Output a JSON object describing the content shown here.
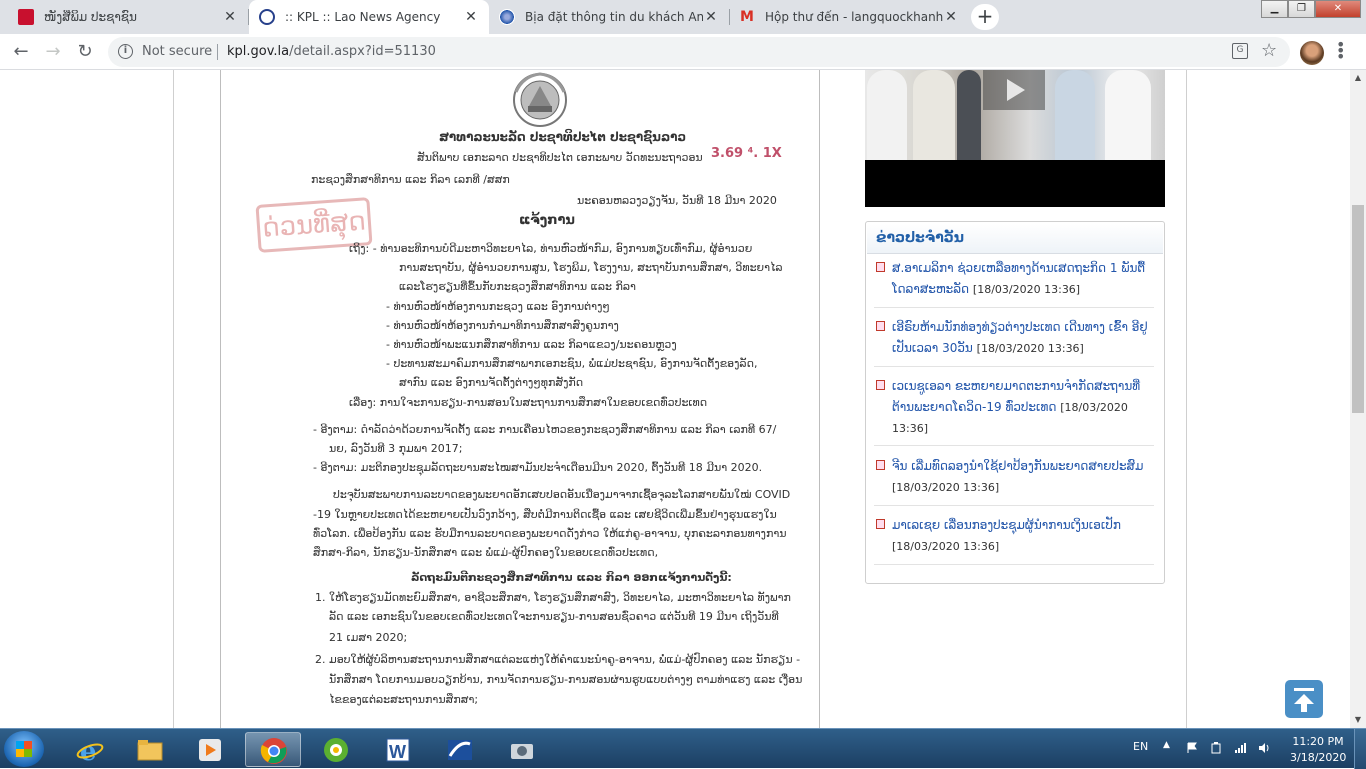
{
  "tabs": [
    {
      "title": "ໜັງສືພິມ ປະຊາຊົນ",
      "favicon": "pasaxon-icon",
      "active": false
    },
    {
      "title": ":: KPL :: Lao News Agency",
      "favicon": "kpl-icon",
      "active": true
    },
    {
      "title": "Bịa đặt thông tin du khách Anh d",
      "favicon": "web-icon",
      "active": false
    },
    {
      "title": "Hộp thư đến - langquockhanh@",
      "favicon": "gmail-icon",
      "active": false
    }
  ],
  "toolbar": {
    "security_label": "Not secure",
    "url_host": "kpl.gov.la",
    "url_path": "/detail.aspx?id=51130"
  },
  "document": {
    "stamp_text": "ດ່ວນທີ່ສຸດ",
    "received_no": "3.69 ⁴. 1X",
    "lines": [
      "ສາທາລະນະລັດ ປະຊາທິປະໄຕ ປະຊາຊົນລາວ",
      "ສັນຕິພາບ ເອກະລາດ ປະຊາທິປະໄຕ ເອກະພາບ ວັດທະນະຖາວອນ",
      "ກະຊວງສຶກສາທິການ ແລະ ກິລາ                                   ເລກທີ          /ສສກ",
      "ນະຄອນຫລວງວຽງຈັນ, ວັນທີ 18 ມີນາ 2020",
      "ແຈ້ງການ",
      "ເຖິງ:  -   ທ່ານອະທິການບໍດີມະຫາວິທະຍາໄລ, ທ່ານຫົວໜ້າກົມ, ອົງການທຽບເທົ່າກົມ, ຜູ້ອຳນວຍ",
      "ການສະຖາບັນ, ຜູ້ອຳນວຍການສູນ, ໂຮງພິມ, ໂຮງງານ, ສະຖາບັນການສຶກສາ, ວິທະຍາໄລ",
      "ແລະໂຮງຮຽນທີ່ຂຶ້ນກັບກະຊວງສຶກສາທິການ ແລະ ກິລາ",
      "-   ທ່ານຫົວໜ້າຫ້ອງການກະຊວງ ແລະ ອົງການຕ່າງໆ",
      "-   ທ່ານຫົວໜ້າຫ້ອງການກຳມາທິການສຶກສາສົງຄູນກາງ",
      "-   ທ່ານຫົວໜ້າພະແນກສຶກສາທິການ ແລະ ກິລາແຂວງ/ນະຄອນຫຼວງ",
      "-   ປະທານສະມາຄົມການສຶກສາພາກເອກະຊົນ, ພໍ່ແມ່ປະຊາຊົນ, ອົງການຈັດຕັ້ງຂອງລັດ,",
      "ສາກົນ ແລະ ອົງການຈັດຕັ້ງຕ່າງໆທຸກສັງກັດ",
      "ເລື່ອງ: ການໃຈະການຮຽນ-ການສອນໃນສະຖານການສຶກສາໃນຂອບເຂດທົ່ວປະເທດ",
      "-  ອີງຕາມ: ດຳລັດວ່າດ້ວຍການຈັດຕັ້ງ ແລະ ການເຄື່ອນໄຫວຂອງກະຊວງສຶກສາທິການ ແລະ ກິລາ ເລກທີ 67/",
      "ນຍ, ລົງວັນທີ 3 ກຸມພາ 2017;",
      "-  ອີງຕາມ: ມະຕິກອງປະຊຸມລັດຖະບານສະໄໝສາມັນປະຈຳເດືອນມີນາ 2020, ຕົ້ງວັນທີ 18 ມີນາ 2020.",
      "ປະຈຸບັນສະພາບການລະບາດຂອງພະຍາດອັກເສບປອດອັນເນື່ອງມາຈາກເຊື້ອຈຸລະໂລກສາຍພັນໃໝ່ COVID",
      "-19 ໃນຫຼາຍປະເທດໄດ້ຂະຫຍາຍເປັນວົງກວ້າງ, ສືບຕໍ່ມີການຕິດເຊື້ອ ແລະ ເສຍຊີວິດເພີ່ມຂຶ້ນຢ່າງຮຸນແຮງໃນ",
      "ທົ່ວໂລກ. ເພື່ອປ້ອງກັນ ແລະ ຮັບມືການລະບາດຂອງພະຍາດດັ່ງກ່າວ ໃຫ້ແກ່ຄູ-ອາຈານ, ບຸກຄະລາກອນທາງການ",
      "ສຶກສາ-ກິລາ, ນັກຮຽນ-ນັກສຶກສາ ແລະ ພໍ່ແມ່-ຜູ້ປົກຄອງໃນຂອບເຂດທົ່ວປະເທດ,",
      "ລັດຖະມົນຕີກະຊວງສຶກສາທິການ ແລະ ກິລາ ອອກແຈ້ງການດັ່ງນີ້:",
      "1.  ໃຫ້ໂຮງຮຽນມັດທະຍົມສຶກສາ, ອາຊີວະສຶກສາ, ໂຮງຮຽນສຶກສາສົງ, ວິທະຍາໄລ, ມະຫາວິທະຍາໄລ ທັງພາກ",
      "ລັດ ແລະ ເອກະຊົນໃນຂອບເຂດທົ່ວປະເທດໃຈະການຮຽນ-ການສອນຊົ່ວຄາວ ແຕ່ວັນທີ 19 ມີນາ ເຖິງວັນທີ",
      "21 ເມສາ 2020;",
      "2.  ມອບໃຫ້ຜູ້ບໍລິຫານສະຖານການສຶກສາແຕ່ລະແຫ່ງໃຫ້ຄຳແນະນຳຄູ-ອາຈານ, ພໍ່ແມ່-ຜູ້ປົກຄອງ ແລະ ນັກຮຽນ -",
      "ນັກສຶກສາ ໂດຍການມອບວຽກບ້ານ, ການຈັດການຮຽນ-ການສອນຜ່ານຮູບແບບຕ່າງໆ ຕາມທ່າແຮງ ແລະ ເງື່ອນ",
      "ໄຂຂອງແຕ່ລະສະຖານການສຶກສາ;"
    ]
  },
  "news": {
    "heading": "ຂ່າວປະຈຳວັນ",
    "items": [
      {
        "text": "ສ.ອາເມລິກາ ຊ່ວຍເຫລືອທາງດ້ານເສດຖະກິດ 1 ພັນຕື້ໂດລາສະຫະລັດ",
        "date": "[18/03/2020 13:36]"
      },
      {
        "text": "ເອີຣົບຫ້າມນັກທ່ອງທ່ຽວຕ່າງປະເທດ ເດີນທາງ ເຂົ້າ ອີຢູ ເປັນເວລາ 30ວັນ",
        "date": "[18/03/2020 13:36]"
      },
      {
        "text": "ເວເນຊູເອລາ ຂະຫຍາຍມາດຕະການຈຳກັດສະຖານທີ່ ຕ້ານພະຍາດໂຄວິດ-19 ທົ່ວປະເທດ",
        "date": "[18/03/2020 13:36]"
      },
      {
        "text": "ຈີນ ເລີ່ມທົດລອງນຳໃຊ້ຢາປ້ອງກັນພະຍາດສາຍປະສົມ",
        "date": "[18/03/2020 13:36]"
      },
      {
        "text": "ມາເລເຊຍ ເລື່ອນກອງປະຊຸມຜູ້ນຳການເງິນເອເປັກ",
        "date": "[18/03/2020 13:36]"
      }
    ]
  },
  "taskbar": {
    "lang": "EN",
    "time": "11:20 PM",
    "date": "3/18/2020"
  },
  "colors": {
    "accent": "#2260a8",
    "taskbar": "#1c3f63"
  }
}
